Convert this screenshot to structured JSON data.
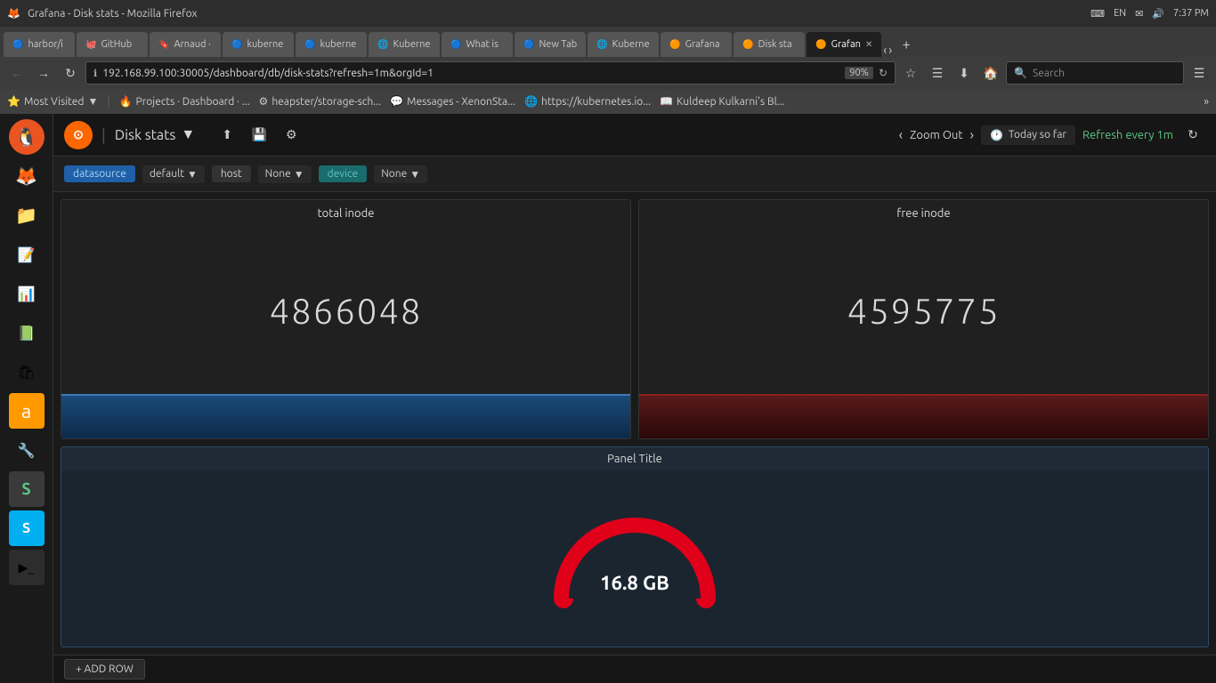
{
  "titlebar": {
    "title": "Grafana - Disk stats - Mozilla Firefox",
    "time": "7:37 PM",
    "lang": "EN"
  },
  "tabs": [
    {
      "id": "harbor",
      "label": "harbor/i",
      "icon": "🔵",
      "active": false,
      "closable": false
    },
    {
      "id": "github",
      "label": "GitHub",
      "icon": "🐙",
      "active": false,
      "closable": false
    },
    {
      "id": "arnaud",
      "label": "Arnaud ·",
      "icon": "🔖",
      "active": false,
      "closable": false
    },
    {
      "id": "kube1",
      "label": "kuberne",
      "icon": "🔵",
      "active": false,
      "closable": false
    },
    {
      "id": "kube2",
      "label": "kuberne",
      "icon": "🔵",
      "active": false,
      "closable": false
    },
    {
      "id": "kube3",
      "label": "Kuberne",
      "icon": "🔵",
      "active": false,
      "closable": false
    },
    {
      "id": "whatis",
      "label": "What is",
      "icon": "🔵",
      "active": false,
      "closable": false
    },
    {
      "id": "newtab",
      "label": "New Tab",
      "icon": "🔵",
      "active": false,
      "closable": false
    },
    {
      "id": "kube4",
      "label": "Kuberne",
      "icon": "🌐",
      "active": false,
      "closable": false
    },
    {
      "id": "grafana1",
      "label": "Grafana",
      "icon": "🟠",
      "active": false,
      "closable": false
    },
    {
      "id": "disksta",
      "label": "Disk sta",
      "icon": "🟠",
      "active": false,
      "closable": false
    },
    {
      "id": "grafana2",
      "label": "Grafan",
      "icon": "🟠",
      "active": true,
      "closable": true
    }
  ],
  "address_bar": {
    "url": "192.168.99.100:30005/dashboard/db/disk-stats?refresh=1m&orgId=1",
    "zoom": "90%"
  },
  "search": {
    "placeholder": "Search"
  },
  "bookmarks": [
    {
      "id": "most-visited",
      "label": "Most Visited",
      "icon": "⭐",
      "has_arrow": true
    },
    {
      "id": "projects-dashboard",
      "label": "Projects · Dashboard · ...",
      "icon": "🔥"
    },
    {
      "id": "heapster-storage",
      "label": "heapster/storage-sch...",
      "icon": "⚙"
    },
    {
      "id": "messages-xenon",
      "label": "Messages - XenonSta...",
      "icon": "💬"
    },
    {
      "id": "kubernetes-io",
      "label": "https://kubernetes.io...",
      "icon": "🌐"
    },
    {
      "id": "kuldeep",
      "label": "Kuldeep Kulkarni's Bl...",
      "icon": "📖"
    }
  ],
  "grafana": {
    "logo": "G",
    "dashboard_title": "Disk stats",
    "toolbar_buttons": [
      "share",
      "save",
      "settings"
    ],
    "time_range": "Today so far",
    "refresh_label": "Refresh every 1m"
  },
  "filters": {
    "datasource_label": "datasource",
    "host_label": "host",
    "device_label": "device",
    "default_option": "default",
    "none_option": "None"
  },
  "panels": {
    "total_inode": {
      "title": "total inode",
      "value": "4866048"
    },
    "free_inode": {
      "title": "free inode",
      "value": "4595775"
    },
    "panel_title": {
      "title": "Panel Title",
      "gauge_value": "16.8 GB"
    }
  },
  "add_row": {
    "label": "+ ADD ROW"
  },
  "sidebar_icons": [
    {
      "id": "ubuntu",
      "icon": "🐧",
      "class": "ubuntu"
    },
    {
      "id": "back",
      "icon": "◀",
      "class": ""
    },
    {
      "id": "firefox",
      "icon": "🦊",
      "class": ""
    },
    {
      "id": "files",
      "icon": "📁",
      "class": ""
    },
    {
      "id": "libreoffice-writer",
      "icon": "📝",
      "class": ""
    },
    {
      "id": "libreoffice-impress",
      "icon": "📊",
      "class": ""
    },
    {
      "id": "libreoffice-calc",
      "icon": "📗",
      "class": ""
    },
    {
      "id": "software-center",
      "icon": "🛍",
      "class": ""
    },
    {
      "id": "amazon",
      "icon": "🅰",
      "class": ""
    },
    {
      "id": "settings",
      "icon": "🔧",
      "class": ""
    },
    {
      "id": "text-editor",
      "icon": "S",
      "class": ""
    },
    {
      "id": "skype",
      "icon": "S",
      "class": ""
    },
    {
      "id": "terminal",
      "icon": "▶",
      "class": ""
    }
  ]
}
